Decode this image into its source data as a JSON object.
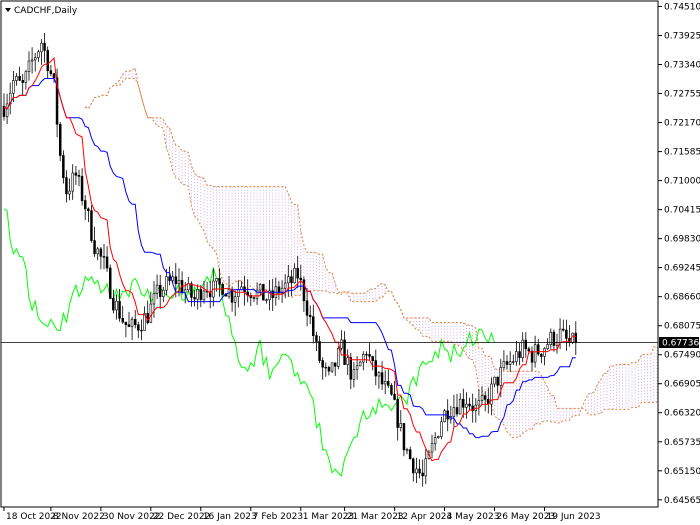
{
  "title": "CADCHF,Daily",
  "colors": {
    "background": "#ffffff",
    "frame": "#000000",
    "candle": "#000000",
    "tenkan": "#ff0000",
    "kijun": "#0000ff",
    "chikou": "#00ff00",
    "senkou": "#e08040",
    "cloud": "#c8a0d8",
    "price_line": "#000000",
    "badge": "#000000"
  },
  "chart_data": {
    "type": "candlestick",
    "title": "CADCHF,Daily",
    "price_range": [
      0.6442,
      0.7462
    ],
    "y_ticks": [
      "0.74510",
      "0.73925",
      "0.73340",
      "0.72755",
      "0.72170",
      "0.71585",
      "0.71000",
      "0.70415",
      "0.69830",
      "0.69245",
      "0.68660",
      "0.68075",
      "0.67490",
      "0.66905",
      "0.66320",
      "0.65735",
      "0.65150",
      "0.64565"
    ],
    "x_ticks": [
      {
        "label": "18 Oct 2022",
        "bar": 0
      },
      {
        "label": "8 Nov 2022",
        "bar": 15
      },
      {
        "label": "30 Nov 2022",
        "bar": 31
      },
      {
        "label": "22 Dec 2022",
        "bar": 47
      },
      {
        "label": "16 Jan 2023",
        "bar": 63
      },
      {
        "label": "7 Feb 2023",
        "bar": 79
      },
      {
        "label": "1 Mar 2023",
        "bar": 95
      },
      {
        "label": "21 Mar 2023",
        "bar": 109
      },
      {
        "label": "12 Apr 2023",
        "bar": 125
      },
      {
        "label": "4 May 2023",
        "bar": 141
      },
      {
        "label": "26 May 2023",
        "bar": 157
      },
      {
        "label": "19 Jun 2023",
        "bar": 173
      }
    ],
    "current_price": "0.67736",
    "current_value": 0.67736,
    "visible_bars": 184,
    "ohlc_anchors": [
      [
        0,
        0.725
      ],
      [
        3,
        0.73
      ],
      [
        6,
        0.729
      ],
      [
        9,
        0.734
      ],
      [
        12,
        0.738
      ],
      [
        14,
        0.734
      ],
      [
        16,
        0.729
      ],
      [
        18,
        0.715
      ],
      [
        20,
        0.708
      ],
      [
        23,
        0.711
      ],
      [
        26,
        0.705
      ],
      [
        29,
        0.697
      ],
      [
        32,
        0.693
      ],
      [
        35,
        0.686
      ],
      [
        38,
        0.682
      ],
      [
        40,
        0.68
      ],
      [
        43,
        0.681
      ],
      [
        46,
        0.683
      ],
      [
        49,
        0.687
      ],
      [
        52,
        0.689
      ],
      [
        55,
        0.69
      ],
      [
        58,
        0.688
      ],
      [
        61,
        0.686
      ],
      [
        64,
        0.689
      ],
      [
        67,
        0.688
      ],
      [
        70,
        0.689
      ],
      [
        73,
        0.687
      ],
      [
        76,
        0.689
      ],
      [
        79,
        0.688
      ],
      [
        82,
        0.687
      ],
      [
        85,
        0.686
      ],
      [
        88,
        0.688
      ],
      [
        91,
        0.689
      ],
      [
        94,
        0.691
      ],
      [
        96,
        0.687
      ],
      [
        98,
        0.682
      ],
      [
        100,
        0.676
      ],
      [
        102,
        0.672
      ],
      [
        104,
        0.67
      ],
      [
        106,
        0.673
      ],
      [
        108,
        0.676
      ],
      [
        110,
        0.673
      ],
      [
        112,
        0.67
      ],
      [
        114,
        0.673
      ],
      [
        116,
        0.676
      ],
      [
        118,
        0.672
      ],
      [
        120,
        0.67
      ],
      [
        122,
        0.668
      ],
      [
        124,
        0.666
      ],
      [
        126,
        0.662
      ],
      [
        128,
        0.657
      ],
      [
        130,
        0.654
      ],
      [
        132,
        0.652
      ],
      [
        134,
        0.65
      ],
      [
        136,
        0.654
      ],
      [
        138,
        0.658
      ],
      [
        140,
        0.662
      ],
      [
        142,
        0.664
      ],
      [
        145,
        0.665
      ],
      [
        148,
        0.666
      ],
      [
        151,
        0.664
      ],
      [
        154,
        0.665
      ],
      [
        157,
        0.669
      ],
      [
        160,
        0.672
      ],
      [
        163,
        0.674
      ],
      [
        166,
        0.676
      ],
      [
        169,
        0.675
      ],
      [
        172,
        0.676
      ],
      [
        175,
        0.678
      ],
      [
        178,
        0.679
      ],
      [
        181,
        0.677
      ],
      [
        183,
        0.67736
      ]
    ]
  }
}
